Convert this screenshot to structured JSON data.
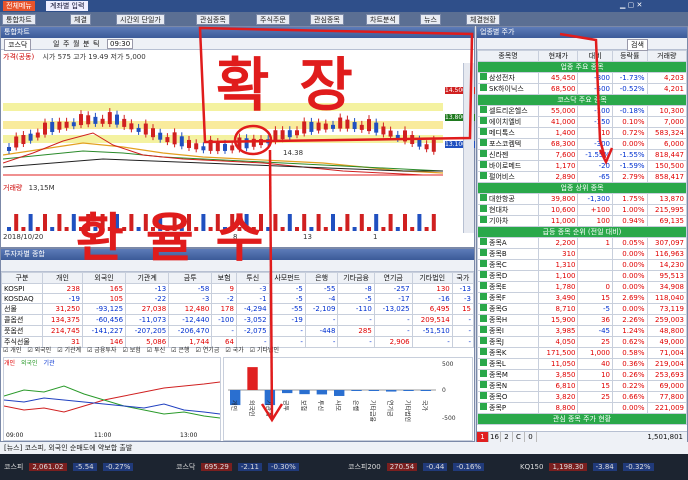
{
  "app": {
    "menu_label": "전체메뉴",
    "account_label": "계좌별 입력",
    "pages": [
      "1",
      "2",
      "3"
    ],
    "tabs": [
      "통합차트",
      "체결",
      "시간외 단일가",
      "관심종목",
      "주식주문",
      "관심종목",
      "차트분석",
      "뉴스",
      "체결현황"
    ]
  },
  "chart_win": {
    "title": "통합차트",
    "period_tabs": [
      "일",
      "주",
      "월",
      "분",
      "틱"
    ],
    "time_value": "09:30",
    "stock_name": "코스닥",
    "price_line1": "가격(공동)",
    "price_legend": "시가 575 고가 19.49 저가 5,000",
    "volume_label": "거래량",
    "volume_value": "13,15M",
    "date_label": "2018/10/20",
    "axis_marks": [
      "8",
      "13",
      "1"
    ],
    "mid_label": "14.38",
    "right_prices": [
      "14.500",
      "13.800",
      "13.100"
    ]
  },
  "investor_win": {
    "title": "투자자별 종합",
    "headers": [
      "구분",
      "개인",
      "외국인",
      "기관계",
      "금투",
      "보험",
      "투신",
      "사모펀드",
      "은행",
      "기타금융",
      "연기금",
      "기타법인",
      "국가"
    ],
    "rows": [
      [
        "KOSPI",
        "238",
        "165",
        "-13",
        "-58",
        "9",
        "-3",
        "-5",
        "-55",
        "-8",
        "-257",
        "130",
        "-13"
      ],
      [
        "KOSDAQ",
        "-19",
        "105",
        "-22",
        "-3",
        "-2",
        "-1",
        "-5",
        "-4",
        "-5",
        "-17",
        "-16",
        "-3"
      ],
      [
        "선물",
        "31,250",
        "-93,125",
        "27,038",
        "12,480",
        "178",
        "-4,294",
        "-55",
        "-2,109",
        "-110",
        "-13,025",
        "6,495",
        "15"
      ],
      [
        "콜옵션",
        "134,375",
        "-60,456",
        "-11,073",
        "-12,440",
        "-100",
        "-3,052",
        "-19",
        "-",
        "-",
        "-",
        "209,514",
        "-"
      ],
      [
        "풋옵션",
        "214,745",
        "-141,227",
        "-207,205",
        "-206,470",
        "-",
        "-2,075",
        "-",
        "-448",
        "285",
        "-",
        "-51,510",
        "-"
      ],
      [
        "주식선물",
        "31",
        "146",
        "5,086",
        "1,744",
        "64",
        "-",
        "-",
        "-",
        "-",
        "2,906",
        "-",
        "-"
      ]
    ],
    "checks": [
      "개인",
      "외국인",
      "기관계",
      "금융투자",
      "보험",
      "투신",
      "은행",
      "연기금",
      "국가",
      "기타법인"
    ],
    "line_legend": [
      "개인",
      "외국인",
      "기관"
    ],
    "line_x": [
      "09:00",
      "11:00",
      "13:00"
    ],
    "bar_labels": [
      "개인",
      "외국인",
      "기관계",
      "금투",
      "보험",
      "투신",
      "사모",
      "은행",
      "기타금융",
      "연기금",
      "기타법인",
      "국가"
    ],
    "bar_values": [
      -580,
      880,
      -580,
      -120,
      -160,
      -170,
      -230,
      -10,
      -5,
      -60,
      -10,
      -5
    ],
    "bar_axis": [
      "500",
      "0",
      "-500"
    ]
  },
  "rank_win": {
    "title": "업종별 주가",
    "search_label": "검색",
    "headers": [
      "종목명",
      "현재가",
      "대비",
      "등락률",
      "거래량"
    ],
    "sections": [
      {
        "title": "업종 주요 종목",
        "rows": [
          [
            "삼성전자",
            "45,450",
            "-800",
            "-1.73%",
            "4,203"
          ],
          [
            "SK하이닉스",
            "68,500",
            "-500",
            "-0.52%",
            "4,201"
          ]
        ]
      },
      {
        "title": "코스닥 주요 종목",
        "rows": [
          [
            "셀트리온헬스",
            "55,000",
            "-100",
            "-0.18%",
            "10,300"
          ],
          [
            "에이치엘비",
            "41,000",
            "-150",
            "0.10%",
            "7,000"
          ],
          [
            "메디톡스",
            "1,400",
            "10",
            "0.72%",
            "583,324"
          ],
          [
            "포스코켐텍",
            "68,300",
            "-300",
            "0.00%",
            "6,000"
          ],
          [
            "신라젠",
            "7,600",
            "-1.55%",
            "-1.55%",
            "818,447"
          ],
          [
            "바이로메드",
            "1,170",
            "-20",
            "-1.59%",
            "150,500"
          ],
          [
            "펄어비스",
            "2,890",
            "-65",
            "2.79%",
            "858,417"
          ]
        ]
      },
      {
        "title": "업종 상위 종목",
        "rows": [
          [
            "대한항공",
            "39,800",
            "-1,300",
            "1.75%",
            "13,870"
          ],
          [
            "현대차",
            "10,600",
            "+100",
            "1.00%",
            "215,995"
          ],
          [
            "기아차",
            "11,000",
            "100",
            "0.94%",
            "69,135"
          ]
        ]
      },
      {
        "title": "급등 종목 순위 (전일 대비)",
        "rows": [
          [
            "종목A",
            "2,200",
            "1",
            "0.05%",
            "307,097"
          ],
          [
            "종목B",
            "310",
            "",
            "0.00%",
            "116,963"
          ],
          [
            "종목C",
            "1,310",
            "",
            "0.00%",
            "14,230"
          ],
          [
            "종목D",
            "1,100",
            "",
            "0.00%",
            "95,513"
          ],
          [
            "종목E",
            "1,780",
            "0",
            "0.00%",
            "34,908"
          ],
          [
            "종목F",
            "3,490",
            "15",
            "2.69%",
            "118,040"
          ],
          [
            "종목G",
            "8,710",
            "-5",
            "0.00%",
            "73,119"
          ],
          [
            "종목H",
            "15,900",
            "36",
            "2.26%",
            "259,003"
          ],
          [
            "종목I",
            "3,985",
            "-45",
            "1.24%",
            "48,800"
          ],
          [
            "종목J",
            "4,050",
            "25",
            "0.62%",
            "49,000"
          ],
          [
            "종목K",
            "171,500",
            "1,000",
            "0.58%",
            "71,004"
          ],
          [
            "종목L",
            "11,050",
            "40",
            "0.36%",
            "219,004"
          ],
          [
            "종목M",
            "3,850",
            "10",
            "0.26%",
            "253,693"
          ],
          [
            "종목N",
            "6,810",
            "15",
            "0.22%",
            "69,000"
          ],
          [
            "종목O",
            "3,820",
            "25",
            "0.66%",
            "77,800"
          ],
          [
            "종목P",
            "8,800",
            "",
            "0.00%",
            "221,009"
          ]
        ]
      },
      {
        "title": "관심 종목 주가 현황",
        "rows": []
      }
    ],
    "pager": [
      "1",
      "16",
      "2",
      "C",
      "0"
    ],
    "page_right": "1,501,801"
  },
  "bottom": {
    "items": [
      {
        "name": "코스피",
        "value": "2,061.02",
        "change": "-5.54",
        "pct": "-0.27%"
      },
      {
        "name": "코스닥",
        "value": "695.29",
        "change": "-2.11",
        "pct": "-0.30%"
      },
      {
        "name": "코스피200",
        "value": "270.54",
        "change": "-0.44",
        "pct": "-0.16%"
      },
      {
        "name": "KQ150",
        "value": "1,198.30",
        "change": "-3.84",
        "pct": "-0.32%"
      }
    ],
    "ticker": "[뉴스] 코스피, 외국인 순매도에 약보합 출발"
  },
  "annotations": {
    "a1": "확장",
    "a2": "환율수"
  }
}
